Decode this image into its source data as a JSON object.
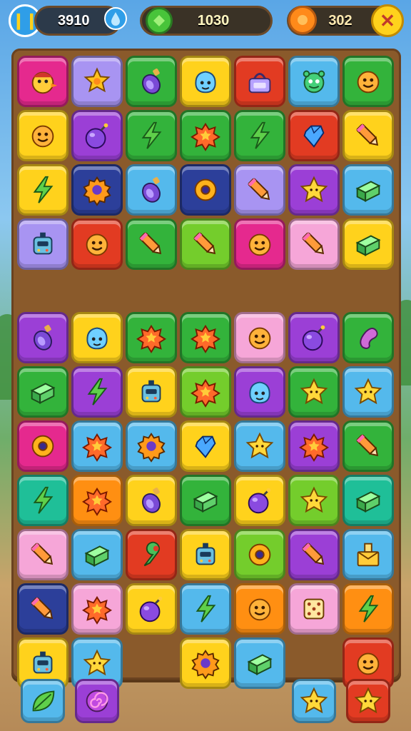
{
  "hud": {
    "moves_value": "3910",
    "coins_value": "1030",
    "lives_value": "302"
  },
  "palette": {
    "pink": "#e5298e",
    "lav": "#a894f2",
    "green": "#33b33b",
    "yellow": "#ffd21c",
    "red": "#e23b22",
    "sky": "#54b9ec",
    "purple": "#9b3fd6",
    "orange": "#ff8f12",
    "navy": "#2c3f9a",
    "lime": "#74cd2c",
    "teal": "#1fbf98",
    "blush": "#f6a6d8"
  },
  "board": {
    "top_rows": [
      [
        [
          "pink",
          "duck-icon"
        ],
        [
          "lav",
          "flower-icon"
        ],
        [
          "green",
          "potion-icon"
        ],
        [
          "yellow",
          "blob-icon"
        ],
        [
          "red",
          "scale-icon"
        ],
        [
          "sky",
          "monster-icon"
        ],
        [
          "green",
          "smiley-icon"
        ]
      ],
      [
        [
          "yellow",
          "smiley-icon"
        ],
        [
          "purple",
          "bomb-icon"
        ],
        [
          "green",
          "lightning-icon"
        ],
        [
          "green",
          "splat-icon"
        ],
        [
          "green",
          "lightning-icon"
        ],
        [
          "red",
          "gem-icon"
        ],
        [
          "yellow",
          "pencil-icon"
        ]
      ],
      [
        [
          "yellow",
          "lightning-icon"
        ],
        [
          "navy",
          "gear-icon"
        ],
        [
          "sky",
          "potion-icon"
        ],
        [
          "navy",
          "donut-icon"
        ],
        [
          "lav",
          "pencil-icon"
        ],
        [
          "purple",
          "star-icon"
        ],
        [
          "sky",
          "block-icon"
        ]
      ],
      [
        [
          "lav",
          "robot-icon"
        ],
        [
          "red",
          "smiley-icon"
        ],
        [
          "green",
          "pencil-icon"
        ],
        [
          "lime",
          "pencil-icon"
        ],
        [
          "pink",
          "smiley-icon"
        ],
        [
          "blush",
          "pencil-icon"
        ],
        [
          "yellow",
          "block-icon"
        ]
      ]
    ],
    "bottom_rows": [
      [
        [
          "purple",
          "potion-icon"
        ],
        [
          "yellow",
          "blob-icon"
        ],
        [
          "green",
          "splat-icon"
        ],
        [
          "green",
          "splat-icon"
        ],
        [
          "blush",
          "smiley-icon"
        ],
        [
          "purple",
          "bomb-icon"
        ],
        [
          "green",
          "bean-icon"
        ]
      ],
      [
        [
          "green",
          "block-icon"
        ],
        [
          "purple",
          "lightning-icon"
        ],
        [
          "yellow",
          "robot-icon"
        ],
        [
          "lime",
          "splat-icon"
        ],
        [
          "purple",
          "blob-icon"
        ],
        [
          "green",
          "star-icon"
        ],
        [
          "sky",
          "star-icon"
        ]
      ],
      [
        [
          "pink",
          "donut-icon"
        ],
        [
          "sky",
          "splat-icon"
        ],
        [
          "sky",
          "gear-icon"
        ],
        [
          "yellow",
          "gem-icon"
        ],
        [
          "sky",
          "star-icon"
        ],
        [
          "purple",
          "splat-icon"
        ],
        [
          "green",
          "pencil-icon"
        ]
      ],
      [
        [
          "teal",
          "lightning-icon"
        ],
        [
          "orange",
          "splat-icon"
        ],
        [
          "yellow",
          "potion-icon"
        ],
        [
          "green",
          "block-icon"
        ],
        [
          "yellow",
          "bomb-icon"
        ],
        [
          "lime",
          "star-icon"
        ],
        [
          "teal",
          "block-icon"
        ]
      ],
      [
        [
          "blush",
          "pencil-icon"
        ],
        [
          "sky",
          "block-icon"
        ],
        [
          "red",
          "wrench-icon"
        ],
        [
          "yellow",
          "robot-icon"
        ],
        [
          "lime",
          "donut-icon"
        ],
        [
          "purple",
          "pencil-icon"
        ],
        [
          "sky",
          "box-icon"
        ]
      ],
      [
        [
          "navy",
          "pencil-icon"
        ],
        [
          "blush",
          "splat-icon"
        ],
        [
          "yellow",
          "bomb-icon"
        ],
        [
          "sky",
          "lightning-icon"
        ],
        [
          "orange",
          "smiley-icon"
        ],
        [
          "blush",
          "dice-icon"
        ],
        [
          "orange",
          "lightning-icon"
        ]
      ],
      [
        [
          "yellow",
          "robot-icon"
        ],
        [
          "sky",
          "star-icon"
        ],
        null,
        [
          "yellow",
          "gear-icon"
        ],
        [
          "sky",
          "block-icon"
        ],
        null,
        [
          "red",
          "smiley-icon"
        ]
      ]
    ],
    "dock": [
      [
        0,
        [
          "sky",
          "leaf-icon"
        ]
      ],
      [
        1,
        [
          "purple",
          "swirl-icon"
        ]
      ],
      [
        5,
        [
          "sky",
          "star-icon"
        ]
      ],
      [
        6,
        [
          "red",
          "star-icon"
        ]
      ]
    ]
  }
}
